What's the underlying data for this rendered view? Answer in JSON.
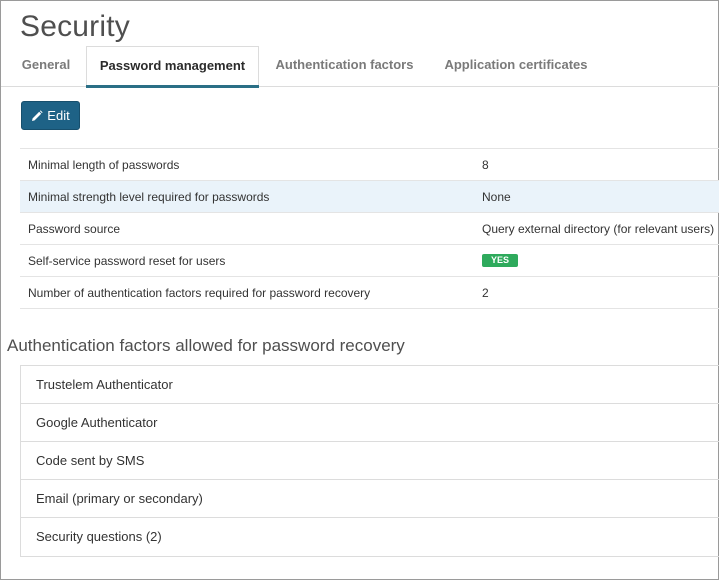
{
  "page": {
    "title": "Security"
  },
  "tabs": [
    {
      "label": "General",
      "active": false
    },
    {
      "label": "Password management",
      "active": true
    },
    {
      "label": "Authentication factors",
      "active": false
    },
    {
      "label": "Application certificates",
      "active": false
    }
  ],
  "toolbar": {
    "edit_label": "Edit",
    "edit_icon": "pencil-icon"
  },
  "properties": [
    {
      "label": "Minimal length of passwords",
      "value": "8"
    },
    {
      "label": "Minimal strength level required for passwords",
      "value": "None"
    },
    {
      "label": "Password source",
      "value": "Query external directory (for relevant users)"
    },
    {
      "label": "Self-service password reset for users",
      "value": "YES"
    },
    {
      "label": "Number of authentication factors required for password recovery",
      "value": "2"
    }
  ],
  "recovery": {
    "title": "Authentication factors allowed for password recovery",
    "factors": [
      "Trustelem Authenticator",
      "Google Authenticator",
      "Code sent by SMS",
      "Email (primary or secondary)",
      "Security questions (2)"
    ]
  },
  "colors": {
    "accent": "#1e6286",
    "tab_underline": "#2a6f86",
    "badge_yes": "#2eaa5c",
    "row_highlight": "#eaf3fa"
  }
}
